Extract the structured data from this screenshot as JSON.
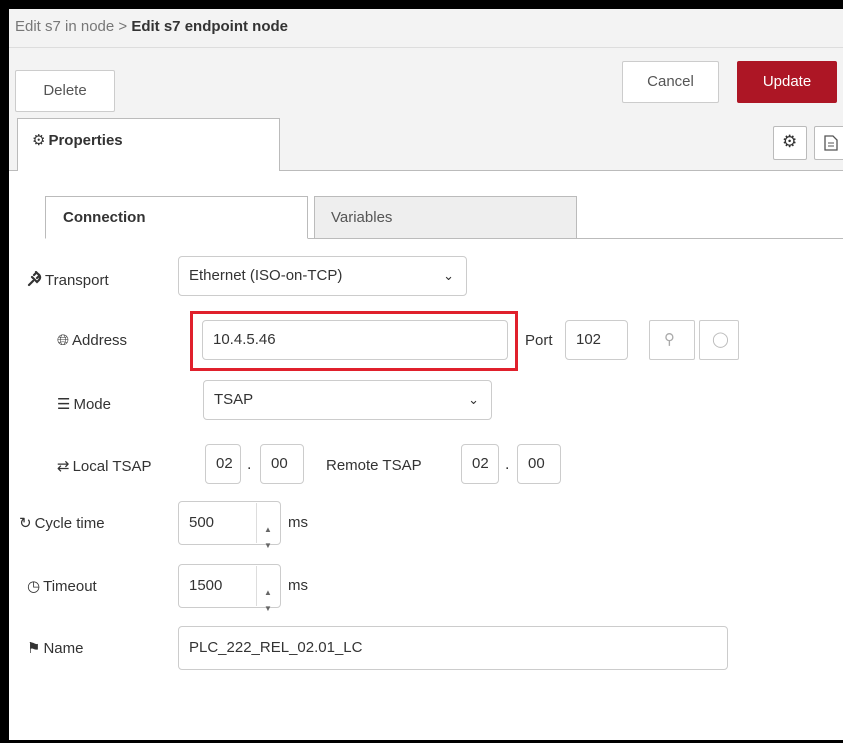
{
  "header": {
    "breadcrumb_prefix": "Edit s7 in node >",
    "title": "Edit s7 endpoint node"
  },
  "toolbar": {
    "delete_label": "Delete",
    "cancel_label": "Cancel",
    "update_label": "Update"
  },
  "tabs": {
    "properties_label": "Properties"
  },
  "inner_tabs": {
    "connection": "Connection",
    "variables": "Variables"
  },
  "form": {
    "transport": {
      "label": "Transport",
      "value": "Ethernet (ISO-on-TCP)"
    },
    "address": {
      "label": "Address",
      "value": "10.4.5.46"
    },
    "port": {
      "label": "Port",
      "value": "102"
    },
    "mode": {
      "label": "Mode",
      "value": "TSAP"
    },
    "local_tsap": {
      "label": "Local TSAP",
      "a": "02",
      "b": "00"
    },
    "remote_tsap": {
      "label": "Remote TSAP",
      "a": "02",
      "b": "00"
    },
    "cycle_time": {
      "label": "Cycle time",
      "value": "500",
      "unit": "ms"
    },
    "timeout": {
      "label": "Timeout",
      "value": "1500",
      "unit": "ms"
    },
    "name": {
      "label": "Name",
      "value": "PLC_222_REL_02.01_LC"
    }
  },
  "colors": {
    "accent": "#ad1625",
    "highlight": "#e0202c"
  }
}
